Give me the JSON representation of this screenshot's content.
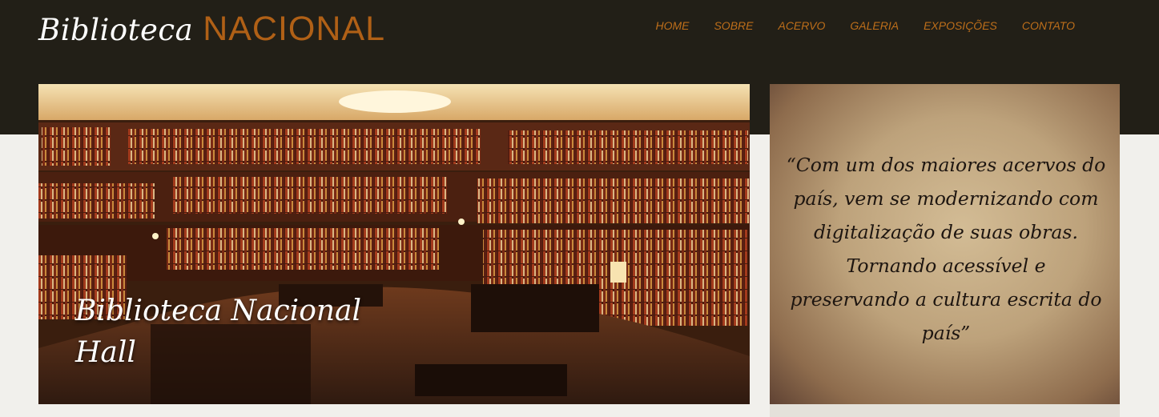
{
  "header": {
    "logo_script": "Biblioteca",
    "logo_caps": "NACIONAL",
    "nav": [
      "HOME",
      "SOBRE",
      "ACERVO",
      "GALERIA",
      "EXPOSIÇÕES",
      "CONTATO"
    ]
  },
  "hero": {
    "caption": "Biblioteca Nacional Hall"
  },
  "quote": {
    "text": "“Com um dos maiores acervos do país, vem se modernizando com digitalização de suas obras. Tornando acessível e preservando a cultura escrita do país”"
  },
  "colors": {
    "header_bg": "#221f17",
    "accent": "#b06016",
    "page_bg": "#f1f0ec"
  }
}
